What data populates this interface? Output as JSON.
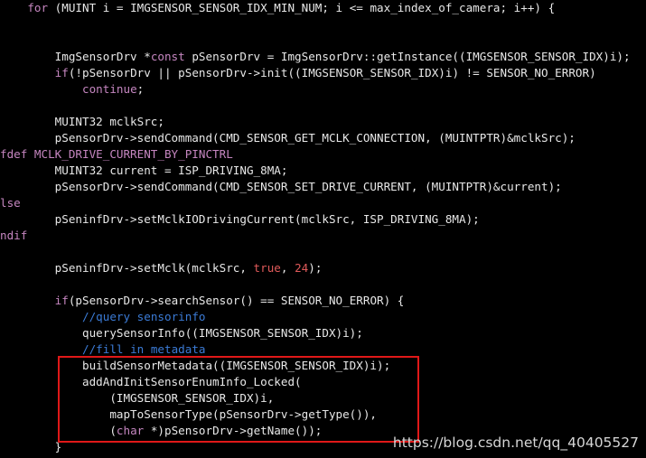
{
  "code": {
    "lines": [
      {
        "segments": [
          {
            "t": "    "
          },
          {
            "t": "for",
            "c": "kw"
          },
          {
            "t": " (MUINT i = IMGSENSOR_SENSOR_IDX_MIN_NUM; i <= max_index_of_camera; i++) {"
          }
        ]
      },
      {
        "segments": []
      },
      {
        "segments": []
      },
      {
        "segments": [
          {
            "t": "        ImgSensorDrv *"
          },
          {
            "t": "const",
            "c": "kw"
          },
          {
            "t": " pSensorDrv = ImgSensorDrv::getInstance((IMGSENSOR_SENSOR_IDX)i);"
          }
        ]
      },
      {
        "segments": [
          {
            "t": "        "
          },
          {
            "t": "if",
            "c": "kw"
          },
          {
            "t": "(!pSensorDrv || pSensorDrv->init((IMGSENSOR_SENSOR_IDX)i) != SENSOR_NO_ERROR)"
          }
        ]
      },
      {
        "segments": [
          {
            "t": "            "
          },
          {
            "t": "continue",
            "c": "kw"
          },
          {
            "t": ";"
          }
        ]
      },
      {
        "segments": []
      },
      {
        "segments": [
          {
            "t": "        MUINT32 mclkSrc;"
          }
        ]
      },
      {
        "segments": [
          {
            "t": "        pSensorDrv->sendCommand(CMD_SENSOR_GET_MCLK_CONNECTION, (MUINTPTR)&mclkSrc);"
          }
        ]
      },
      {
        "segments": [
          {
            "t": "fdef MCLK_DRIVE_CURRENT_BY_PINCTRL",
            "c": "pp"
          }
        ]
      },
      {
        "segments": [
          {
            "t": "        MUINT32 current = ISP_DRIVING_8MA;"
          }
        ]
      },
      {
        "segments": [
          {
            "t": "        pSensorDrv->sendCommand(CMD_SENSOR_SET_DRIVE_CURRENT, (MUINTPTR)&current);"
          }
        ]
      },
      {
        "segments": [
          {
            "t": "lse",
            "c": "pp"
          }
        ]
      },
      {
        "segments": [
          {
            "t": "        pSeninfDrv->setMclkIODrivingCurrent(mclkSrc, ISP_DRIVING_8MA);"
          }
        ]
      },
      {
        "segments": [
          {
            "t": "ndif",
            "c": "pp"
          }
        ]
      },
      {
        "segments": []
      },
      {
        "segments": [
          {
            "t": "        pSeninfDrv->setMclk(mclkSrc, "
          },
          {
            "t": "true",
            "c": "rd"
          },
          {
            "t": ", "
          },
          {
            "t": "24",
            "c": "rd"
          },
          {
            "t": ");"
          }
        ]
      },
      {
        "segments": []
      },
      {
        "segments": [
          {
            "t": "        "
          },
          {
            "t": "if",
            "c": "kw"
          },
          {
            "t": "(pSensorDrv->searchSensor() == SENSOR_NO_ERROR) {"
          }
        ]
      },
      {
        "segments": [
          {
            "t": "            "
          },
          {
            "t": "//query sensorinfo",
            "c": "cm"
          }
        ]
      },
      {
        "segments": [
          {
            "t": "            querySensorInfo((IMGSENSOR_SENSOR_IDX)i);"
          }
        ]
      },
      {
        "segments": [
          {
            "t": "            "
          },
          {
            "t": "//fill in metadata",
            "c": "cm"
          }
        ]
      },
      {
        "segments": [
          {
            "t": "            buildSensorMetadata((IMGSENSOR_SENSOR_IDX)i);"
          }
        ]
      },
      {
        "segments": [
          {
            "t": "            addAndInitSensorEnumInfo_Locked("
          }
        ]
      },
      {
        "segments": [
          {
            "t": "                (IMGSENSOR_SENSOR_IDX)i,"
          }
        ]
      },
      {
        "segments": [
          {
            "t": "                mapToSensorType(pSensorDrv->getType()),"
          }
        ]
      },
      {
        "segments": [
          {
            "t": "                ("
          },
          {
            "t": "char",
            "c": "kw"
          },
          {
            "t": " *)pSensorDrv->getName());"
          }
        ]
      },
      {
        "segments": [
          {
            "t": "        }"
          }
        ]
      }
    ]
  },
  "watermark": "https://blog.csdn.net/qq_40405527",
  "colors": {
    "background": "#000000",
    "text": "#e8e8e8",
    "keyword": "#c586c0",
    "preprocessor": "#c586c0",
    "comment": "#3b7bd6",
    "literal": "#e05a5a",
    "highlight_border": "#e01818"
  }
}
